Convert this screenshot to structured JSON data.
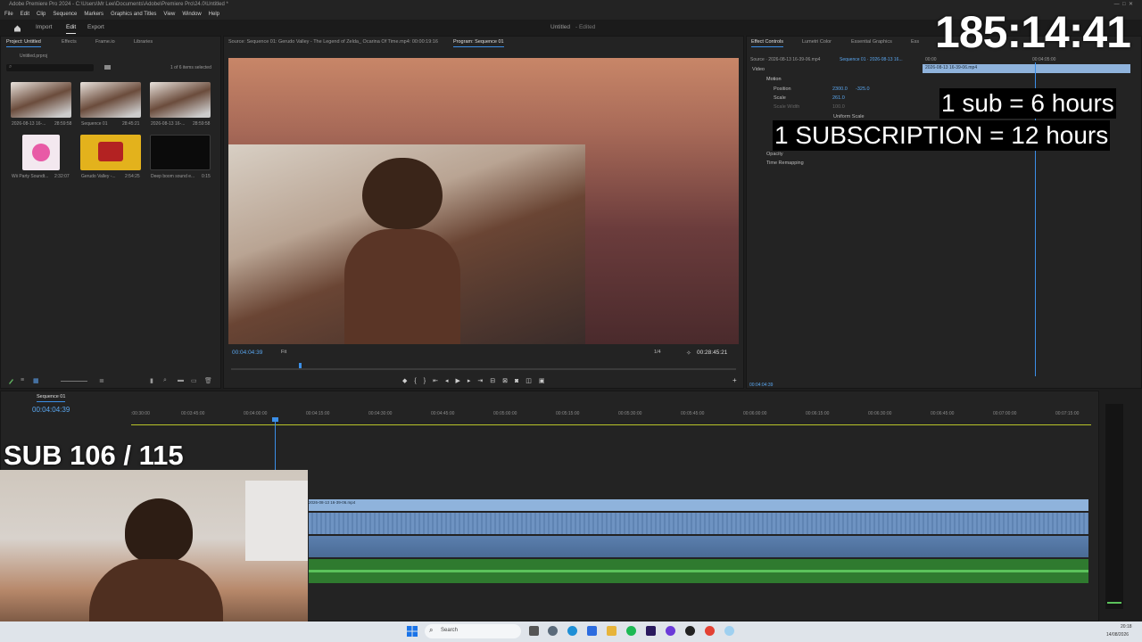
{
  "window": {
    "title": "Adobe Premiere Pro 2024 - C:\\Users\\Mr Lee\\Documents\\Adobe\\Premiere Pro\\24.0\\Untitled *"
  },
  "menu": [
    "File",
    "Edit",
    "Clip",
    "Sequence",
    "Markers",
    "Graphics and Titles",
    "View",
    "Window",
    "Help"
  ],
  "workspace": {
    "import": "Import",
    "edit": "Edit",
    "export": "Export",
    "doc_title": "Untitled",
    "doc_state": "- Edited"
  },
  "project": {
    "tabs": [
      "Project: Untitled",
      "Effects",
      "Frame.io",
      "Libraries"
    ],
    "file": "Untitled.prproj",
    "selected": "1 of 6 items selected",
    "items": [
      {
        "name": "2026-08-13 16-...",
        "duration": "28:59:58"
      },
      {
        "name": "Sequence 01",
        "duration": "28:45:21"
      },
      {
        "name": "2026-08-13 16-...",
        "duration": "28:59:58"
      },
      {
        "name": "Wii Party Soundt...",
        "duration": "2:32:07"
      },
      {
        "name": "Gerudo Valley -...",
        "duration": "2:54:25"
      },
      {
        "name": "Deep boom sound e...",
        "duration": "0:15"
      }
    ]
  },
  "source_tab": "Source: Sequence 01: Gerudo Valley - The Legend of Zelda_ Ocarina Of Time.mp4: 00:00:19:16",
  "program": {
    "tab": "Program: Sequence 01",
    "timecode": "00:04:04:39",
    "fit": "Fit",
    "ratio": "1/4",
    "duration": "00:28:45:21"
  },
  "effects": {
    "tabs": [
      "Effect Controls",
      "Lumetri Color",
      "Essential Graphics",
      "Ess"
    ],
    "source": "Source · 2026-08-13 16-39-06.mp4",
    "seq": "Sequence 01 · 2026-08-13 16...",
    "time_start": "00:00",
    "time_mid": "00:04:05:00",
    "clip": "2026-08-13 16-39-06.mp4",
    "video": "Video",
    "motion": "Motion",
    "position": "Position",
    "pos_x": "2300.0",
    "pos_y": "-325.0",
    "scale": "Scale",
    "scale_val": "261.0",
    "scale_width": "Scale Width",
    "scale_width_val": "100.0",
    "uniform": "Uniform Scale",
    "opacity": "Opacity",
    "remap": "Time Remapping",
    "bottom_time": "00:04:04:39"
  },
  "timeline": {
    "tab": "Sequence 01",
    "timecode": "00:04:04:39",
    "ticks": [
      ":00:30:00",
      "00:03:45:00",
      "00:04:00:00",
      "00:04:15:00",
      "00:04:30:00",
      "00:04:45:00",
      "00:05:00:00",
      "00:05:15:00",
      "00:05:30:00",
      "00:05:45:00",
      "00:06:00:00",
      "00:06:15:00",
      "00:06:30:00",
      "00:06:45:00",
      "00:07:00:00",
      "00:07:15:00"
    ],
    "clip": "2026-08-13 16-39-06.mp4"
  },
  "overlay": {
    "timer": "185:14:41",
    "sub_line": "1 sub = 6 hours",
    "subscription_line": "1 SUBSCRIPTION = 12 hours",
    "sub_count": "SUB 106 / 115"
  },
  "taskbar": {
    "search": "Search",
    "time": "20:18",
    "date": "14/08/2026"
  },
  "colors": {
    "accent": "#3b8fe8",
    "timer": "#ffffff",
    "clip_video": "#8fb3dc",
    "clip_audio": "#6e93c2",
    "clip_green": "#3f8f3f",
    "bg": "#1d1d1d"
  }
}
